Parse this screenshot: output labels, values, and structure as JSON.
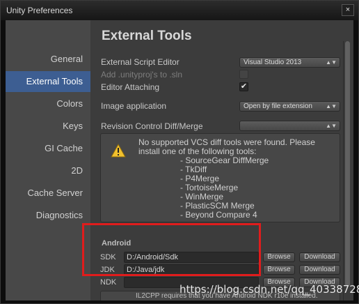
{
  "window": {
    "title": "Unity Preferences",
    "close_glyph": "×"
  },
  "sidebar": {
    "items": [
      {
        "label": "General"
      },
      {
        "label": "External Tools",
        "active": true
      },
      {
        "label": "Colors"
      },
      {
        "label": "Keys"
      },
      {
        "label": "GI Cache"
      },
      {
        "label": "2D"
      },
      {
        "label": "Cache Server"
      },
      {
        "label": "Diagnostics"
      }
    ]
  },
  "main": {
    "title": "External Tools",
    "script_editor": {
      "label": "External Script Editor",
      "value": "Visual Studio 2013"
    },
    "add_unityproj": {
      "label": "Add .unityproj's to .sln",
      "checked": false
    },
    "editor_attaching": {
      "label": "Editor Attaching",
      "checked": true
    },
    "image_application": {
      "label": "Image application",
      "value": "Open by file extension"
    },
    "revision_control": {
      "label": "Revision Control Diff/Merge",
      "value": ""
    },
    "help_box": {
      "icon": "warning-icon",
      "line1": "No supported VCS diff tools were found. Please",
      "line2": "install one of the following tools:",
      "tools": [
        "- SourceGear DiffMerge",
        "- TkDiff",
        "- P4Merge",
        "- TortoiseMerge",
        "- WinMerge",
        "- PlasticSCM Merge",
        "- Beyond Compare 4"
      ]
    },
    "android": {
      "section_label": "Android",
      "sdk": {
        "label": "SDK",
        "value": "D:/Android/Sdk",
        "browse": "Browse",
        "download": "Download"
      },
      "jdk": {
        "label": "JDK",
        "value": "D:/Java/jdk",
        "browse": "Browse",
        "download": "Download"
      },
      "ndk": {
        "label": "NDK",
        "value": "",
        "browse": "Browse",
        "download": "Download"
      },
      "il2cpp_note": "IL2CPP requires that you have Android NDK r10e installed."
    }
  },
  "annotation": {
    "highlight_color": "#e01c1c"
  },
  "watermark": "https://blog.csdn.net/qq_40338728"
}
